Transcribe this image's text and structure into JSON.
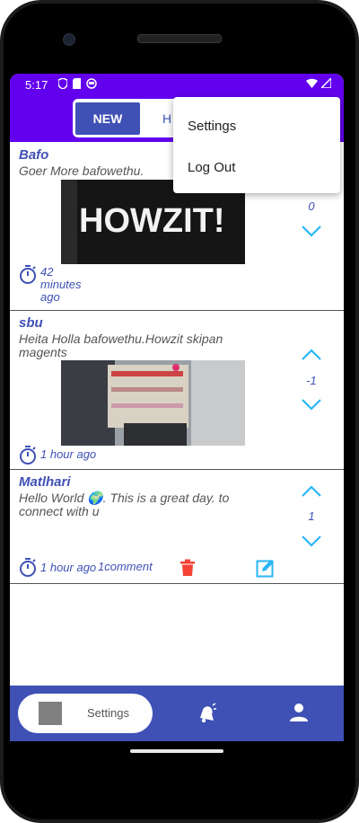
{
  "status_bar": {
    "time": "5:17"
  },
  "tabs": {
    "new_label": "NEW",
    "hot_label_partial": "H"
  },
  "overflow_menu": {
    "items": [
      "Settings",
      "Log Out"
    ]
  },
  "posts": [
    {
      "author": "Bafo",
      "text": "Goer More bafowethu.",
      "image_text": "HOWZIT!",
      "score": "0",
      "time_lines": [
        "42",
        "minutes",
        "ago"
      ]
    },
    {
      "author": "sbu",
      "text_lines": [
        "Heita Holla bafowethu.Howzit skipan",
        "magents"
      ],
      "score": "-1",
      "time": "1 hour ago"
    },
    {
      "author": "Matlhari",
      "text_lines": [
        "Hello World 🌍. This is a great day. to",
        "connect with u"
      ],
      "score": "1",
      "time": "1 hour ago",
      "comments": "1comment"
    }
  ],
  "bottom_nav": {
    "settings_label": "Settings"
  },
  "colors": {
    "primary": "#6200ee",
    "accent": "#3f51b5",
    "icon_blue": "#29b6f6",
    "delete_red": "#f44336"
  }
}
